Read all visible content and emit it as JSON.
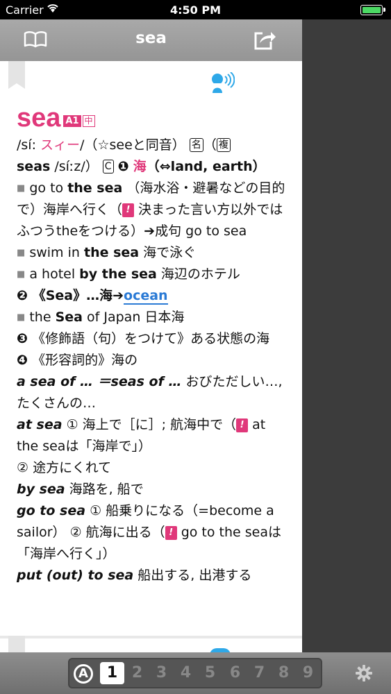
{
  "status": {
    "carrier": "Carrier",
    "time": "4:50 PM"
  },
  "nav": {
    "title": "sea"
  },
  "entry": {
    "headword": "sea",
    "level1": "A1",
    "level2": "中",
    "pron": "/sí: ",
    "kana": "スィー",
    "pron_tail": "/（☆seeと同音）",
    "pos": "名",
    "plural_mark": "複",
    "l2_paren": "（",
    "plural_word": "seas",
    "plural_pron": " /síːz/）",
    "count_mark": "C",
    "s1_num": "❶",
    "s1_head": "海",
    "s1_rest": "（⇔land, earth）",
    "ex1_en_a": "go to ",
    "ex1_en_b": "the sea",
    "ex1_ja": " （海水浴・避暑などの目的で）海岸へ行く（",
    "ex1_note_mark": "!",
    "ex1_note": " 決まった言い方以外ではふつうtheをつける）➔成句 go to sea",
    "ex2_en_a": "swim in ",
    "ex2_en_b": "the sea",
    "ex2_ja": " 海で泳ぐ",
    "ex3_en_a": "a hotel ",
    "ex3_en_b": "by the sea",
    "ex3_ja": " 海辺のホテル",
    "s2_num": "❷",
    "s2_text": " 《Sea》…海➔",
    "s2_link": "ocean",
    "ex4_en_a": "the ",
    "ex4_en_b": "Sea",
    "ex4_en_c": " of Japan",
    "ex4_ja": " 日本海",
    "s3_num": "❸",
    "s3_text": " 《修飾語（句）をつけて》ある状態の海",
    "s4_num": "❹",
    "s4_text": " 《形容詞的》海の",
    "ph1": "a sea of … ＝seas of …",
    "ph1_ja": " おびただしい…, たくさんの…",
    "ph2": "at sea",
    "ph2_ja": " ① 海上で［に］; 航海中で（",
    "ph2_note_mark": "!",
    "ph2_note": " at the seaは「海岸で」）",
    "ph2_ja2": "② 途方にくれて",
    "ph3": "by sea",
    "ph3_ja": " 海路を, 船で",
    "ph4": "go to sea",
    "ph4_ja": " ① 船乗りになる（=become a sailor） ② 航海に出る（",
    "ph4_note_mark": "!",
    "ph4_note": " go to the seaは「海岸へ行く」）",
    "ph5": "put (out) to sea",
    "ph5_ja": " 船出する, 出港する"
  },
  "toolbar": {
    "a_label": "A",
    "tabs": [
      "1",
      "2",
      "3",
      "4",
      "5",
      "6",
      "7",
      "8",
      "9"
    ]
  },
  "icons": {
    "book": "book-icon",
    "share": "share-icon",
    "speaker": "speaker-icon",
    "gear": "gear-icon"
  },
  "colors": {
    "accent": "#e0387a",
    "link": "#2a7ad5",
    "speaker": "#2ea8e8"
  }
}
